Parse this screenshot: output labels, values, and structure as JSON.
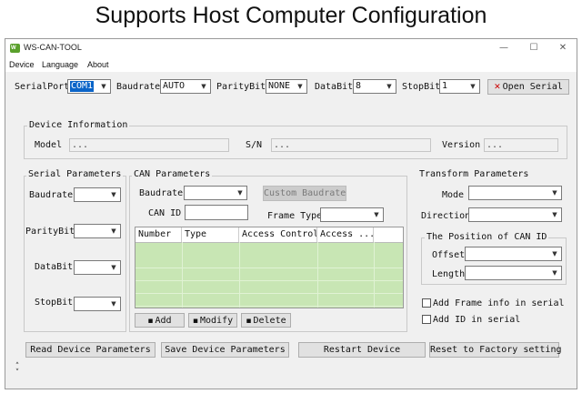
{
  "caption": "Supports Host Computer Configuration",
  "window": {
    "title": "WS-CAN-TOOL",
    "icon_text": "W",
    "icon_color": "#5aa02c",
    "controls": {
      "minimize": "—",
      "maximize": "☐",
      "close": "✕"
    }
  },
  "menu": {
    "items": [
      "Device",
      "Language",
      "About"
    ]
  },
  "serial": {
    "port_label": "SerialPort",
    "port_value": "COM1",
    "baud_label": "Baudrate",
    "baud_value": "AUTO",
    "parity_label": "ParityBit",
    "parity_value": "NONE",
    "data_label": "DataBit",
    "data_value": "8",
    "stop_label": "StopBit",
    "stop_value": "1",
    "open_button": "Open Serial",
    "open_icon": "close-x-icon",
    "open_icon_color": "#cc0000"
  },
  "device_info": {
    "title": "Device Information",
    "model_label": "Model",
    "model_value": "...",
    "sn_label": "S/N",
    "sn_value": "...",
    "version_label": "Version",
    "version_value": "..."
  },
  "serial_params": {
    "title": "Serial Parameters",
    "baud_label": "Baudrate",
    "baud_value": "",
    "parity_label": "ParityBit",
    "parity_value": "",
    "data_label": "DataBit",
    "data_value": "",
    "stop_label": "StopBit",
    "stop_value": ""
  },
  "can_params": {
    "title": "CAN Parameters",
    "baud_label": "Baudrate",
    "baud_value": "",
    "custom_button": "Custom Baudrate",
    "canid_label": "CAN ID",
    "canid_value": "",
    "frame_label": "Frame Type",
    "frame_value": "",
    "table_columns": [
      "Number",
      "Type",
      "Access Control",
      "Access ..."
    ],
    "table_color": "#c8e6b4",
    "add_button": "Add",
    "modify_button": "Modify",
    "delete_button": "Delete"
  },
  "transform": {
    "title": "Transform Parameters",
    "mode_label": "Mode",
    "mode_value": "",
    "direction_label": "Direction",
    "direction_value": "",
    "canid_pos_title": "The Position of CAN ID",
    "offset_label": "Offset",
    "offset_value": "",
    "length_label": "Length",
    "length_value": "",
    "add_frame_label": "Add Frame info in serial",
    "add_frame_checked": false,
    "add_id_label": "Add ID in serial",
    "add_id_checked": false
  },
  "actions": {
    "read": "Read Device Parameters",
    "save": "Save Device Parameters",
    "restart": "Restart Device",
    "reset": "Reset to Factory setting"
  },
  "status_icon": "up-down-arrows-icon"
}
